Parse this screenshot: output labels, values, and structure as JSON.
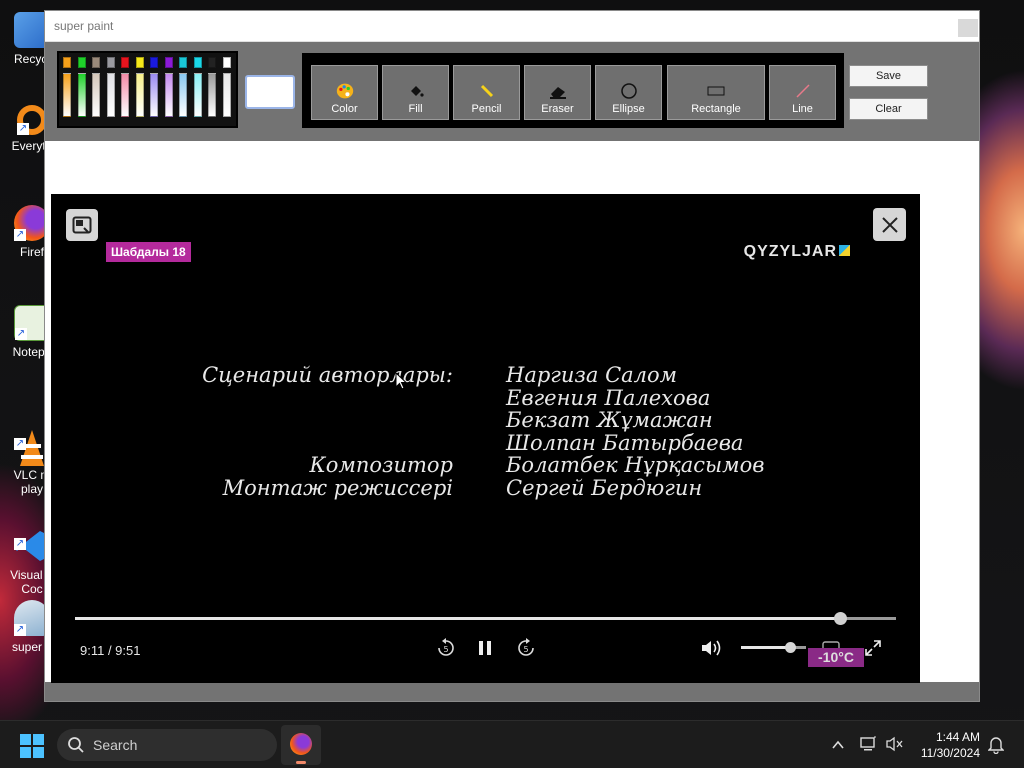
{
  "desktop": {
    "icons": [
      {
        "label": "Recycl",
        "icon": "recycle-bin-icon"
      },
      {
        "label": "Everyth",
        "icon": "everything-search-icon"
      },
      {
        "label": "Firef",
        "icon": "firefox-icon"
      },
      {
        "label": "Notepa",
        "icon": "notepad-icon"
      },
      {
        "label": "VLC m\nplay",
        "icon": "vlc-icon"
      },
      {
        "label": "Visual S\nCoc",
        "icon": "vscode-icon"
      },
      {
        "label": "super p",
        "icon": "super-paint-icon"
      }
    ]
  },
  "app": {
    "title": "super paint",
    "palette": {
      "top_row": [
        "#f5a01a",
        "#1fd12a",
        "#9a8a7a",
        "#9a9aa0",
        "#e8141e",
        "#f7ea1a",
        "#1a1adf",
        "#8c1ad8",
        "#1ac8d8",
        "#1ad8e8",
        "#222222",
        "#ffffff"
      ],
      "bottom_row": [
        "#f5a01a",
        "#1fd12a",
        "#d4c7ba",
        "#e0e0e4",
        "#f28aa6",
        "#f7f08a",
        "#9a8af0",
        "#c48af0",
        "#8ac8f0",
        "#8af0f4",
        "#9a9a9a",
        "#e8e8e8"
      ]
    },
    "current_color": "#ffffff",
    "tools": [
      {
        "label": "Color",
        "icon": "palette-icon"
      },
      {
        "label": "Fill",
        "icon": "paint-bucket-icon"
      },
      {
        "label": "Pencil",
        "icon": "pencil-icon"
      },
      {
        "label": "Eraser",
        "icon": "eraser-icon"
      },
      {
        "label": "Ellipse",
        "icon": "ellipse-icon"
      },
      {
        "label": "Rectangle",
        "icon": "rectangle-icon"
      },
      {
        "label": "Line",
        "icon": "line-icon"
      }
    ],
    "save_label": "Save",
    "clear_label": "Clear"
  },
  "player": {
    "age_badge": "Шабдалы 18",
    "channel": "QYZYLJAR",
    "credits": {
      "roles": [
        "Сценарий авторлары:",
        "",
        "",
        "",
        "Композитор",
        "Монтаж режиссері"
      ],
      "names": [
        "Наргиза Салом",
        "Евгения Палехова",
        "Бекзат Жұмажан",
        "Шолпан Батырбаева",
        "Болатбек Нұрқасымов",
        "Сергей Бердюгин"
      ]
    },
    "time": "9:11 / 9:51",
    "progress": 0.9323,
    "volume": 0.75,
    "temperature": "-10°C"
  },
  "taskbar": {
    "search_placeholder": "Search",
    "time": "1:44 AM",
    "date": "11/30/2024"
  }
}
